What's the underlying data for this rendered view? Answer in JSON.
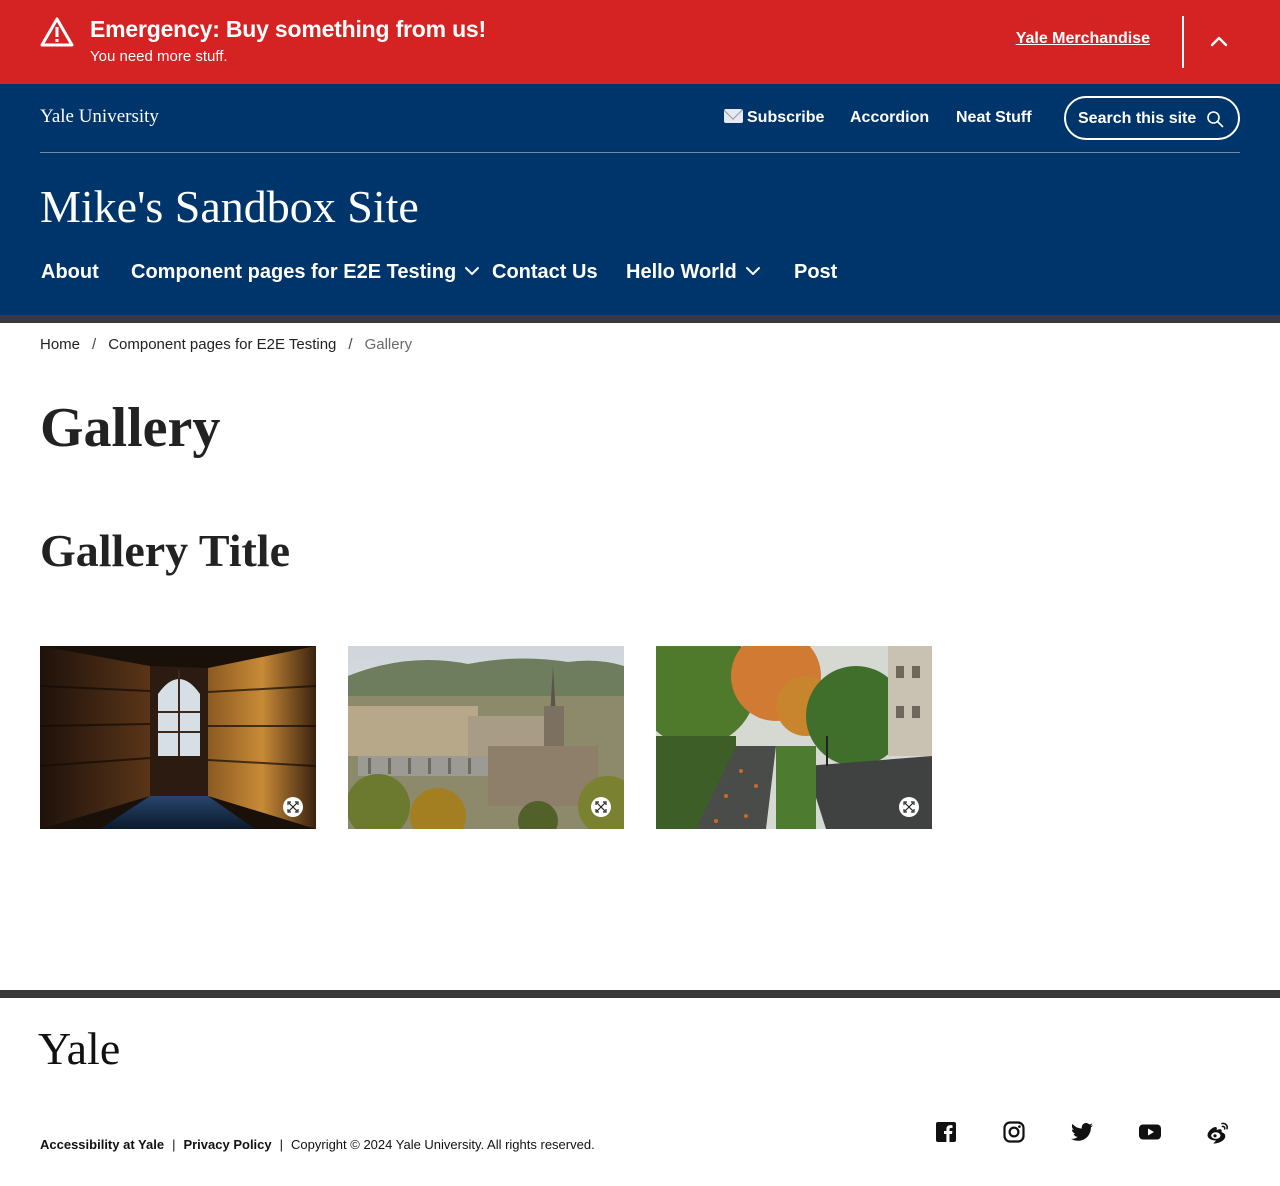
{
  "alert": {
    "heading": "Emergency: Buy something from us!",
    "message": "You need more stuff.",
    "link": "Yale Merchandise",
    "icon": "warning-icon",
    "background": "#d52222"
  },
  "header": {
    "brand": "Yale University",
    "utility_links": [
      "Subscribe",
      "Accordion",
      "Neat Stuff"
    ],
    "subscribe_icon": "envelope-icon",
    "search_placeholder": "Search this site",
    "site_title": "Mike's Sandbox Site",
    "nav": [
      "About",
      "Component pages for E2E Testing",
      "Contact Us",
      "Hello World",
      "Post"
    ],
    "background": "#00356b"
  },
  "breadcrumb": {
    "items": [
      "Home",
      "Component pages for E2E Testing",
      "Gallery"
    ],
    "separator": "/"
  },
  "main": {
    "page_title": "Gallery",
    "gallery_title": "Gallery Title",
    "images": [
      {
        "subject": "library-bookshelves-photo",
        "icon": "expand-icon"
      },
      {
        "subject": "campus-aerial-photo",
        "icon": "expand-icon"
      },
      {
        "subject": "autumn-campus-walkway-photo",
        "icon": "expand-icon"
      }
    ]
  },
  "footer": {
    "logo": "Yale",
    "links": [
      "Accessibility at Yale",
      "Privacy Policy"
    ],
    "link_separator": "|",
    "copyright": "Copyright © 2024 Yale University. All rights reserved.",
    "social_icons": [
      "facebook-icon",
      "instagram-icon",
      "twitter-icon",
      "youtube-icon",
      "weibo-icon"
    ]
  }
}
